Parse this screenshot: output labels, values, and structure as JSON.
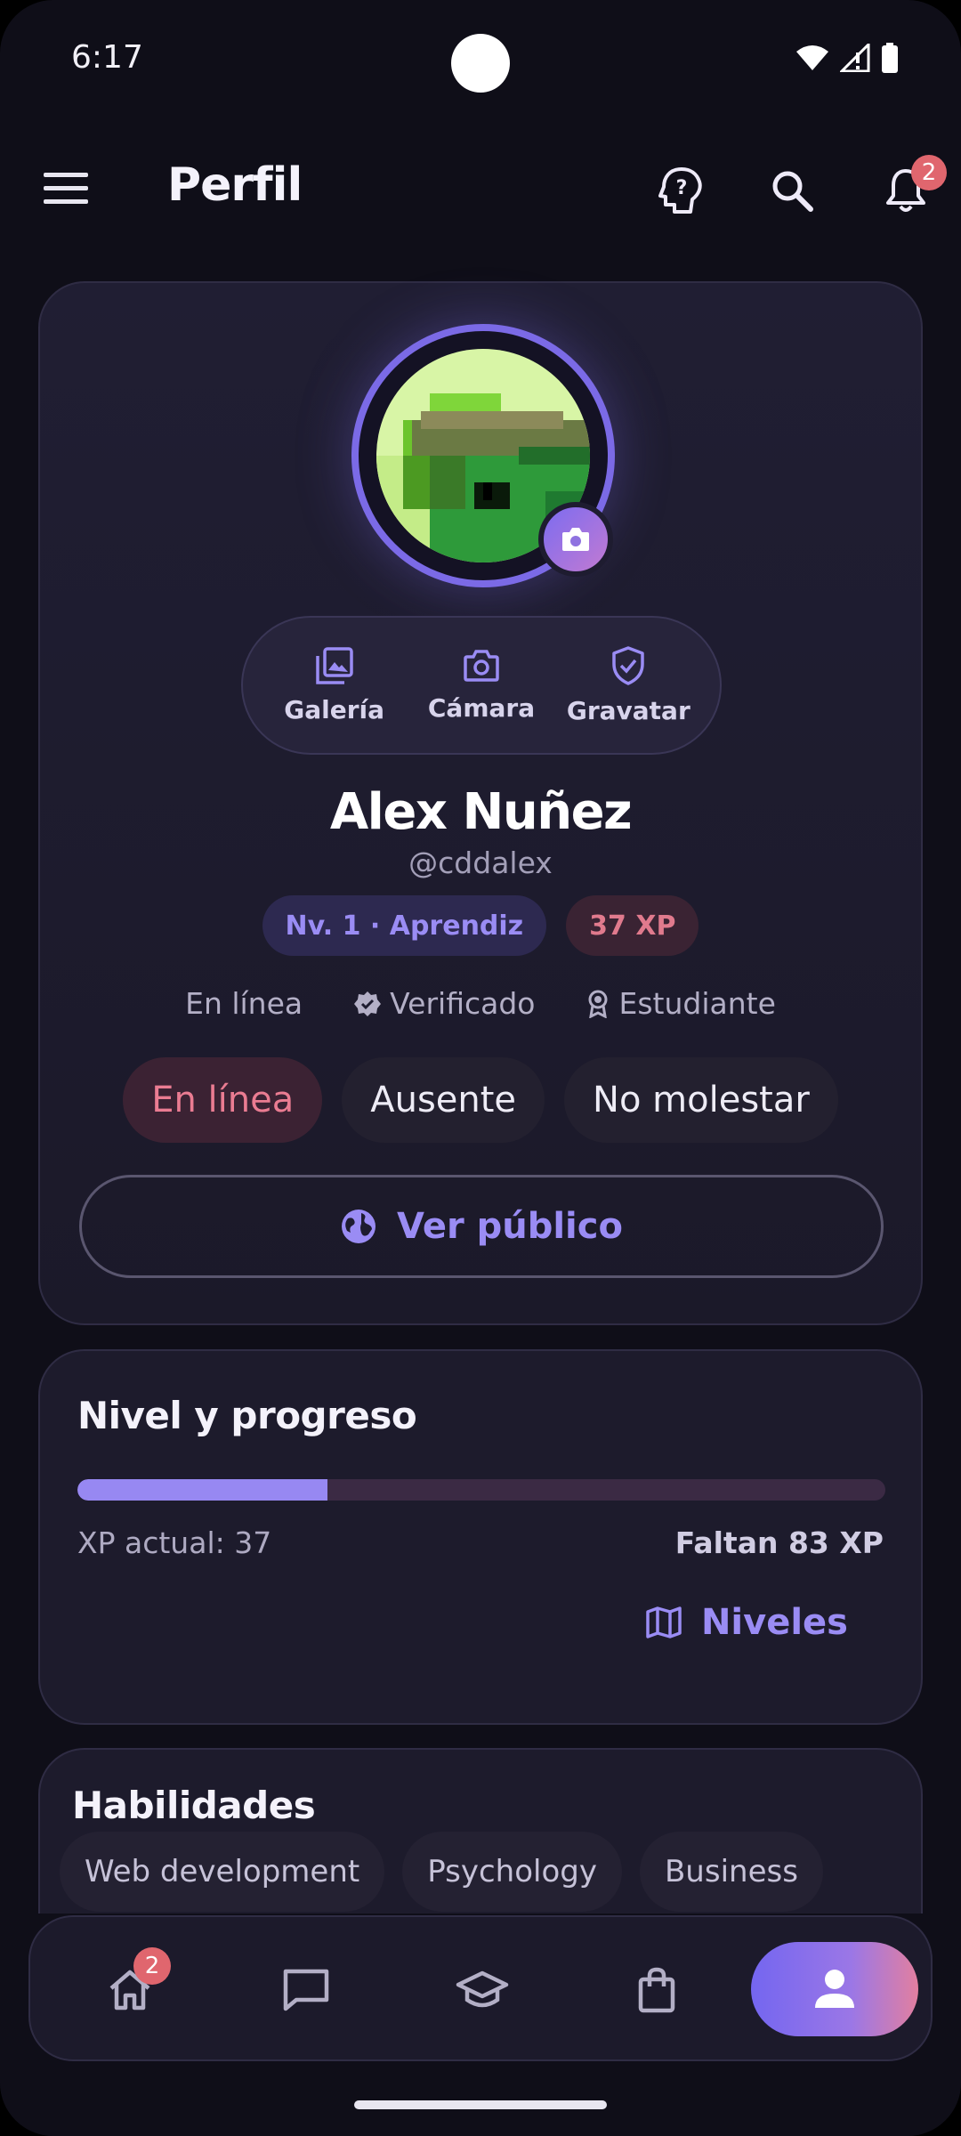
{
  "status_bar": {
    "time": "6:17"
  },
  "app_bar": {
    "title": "Perfil",
    "notification_count": "2"
  },
  "profile": {
    "photo_actions": [
      {
        "label": "Galería",
        "icon": "image-icon"
      },
      {
        "label": "Cámara",
        "icon": "camera-icon"
      },
      {
        "label": "Gravatar",
        "icon": "shield-check-icon"
      }
    ],
    "name": "Alex Nuñez",
    "handle": "@cddalex",
    "level_badge": "Nv. 1 · Aprendiz",
    "xp_badge": "37 XP",
    "meta": {
      "online": "En línea",
      "verified": "Verificado",
      "role": "Estudiante"
    },
    "status_options": [
      {
        "label": "En línea",
        "active": true
      },
      {
        "label": "Ausente",
        "active": false
      },
      {
        "label": "No molestar",
        "active": false
      }
    ],
    "public_button": "Ver público"
  },
  "progress": {
    "title": "Nivel y progreso",
    "fraction": 0.31,
    "current_label": "XP actual: 37",
    "remaining_label": "Faltan 83 XP",
    "levels_button": "Niveles"
  },
  "skills": {
    "title": "Habilidades",
    "items": [
      "Web development",
      "Psychology",
      "Business"
    ]
  },
  "bottom_nav": {
    "home_badge": "2",
    "items": [
      "home-icon",
      "chat-icon",
      "school-icon",
      "shopping-bag-icon",
      "person-icon"
    ]
  },
  "colors": {
    "accent": "#9788f2",
    "danger": "#e0666e",
    "background": "#0f0e18"
  }
}
